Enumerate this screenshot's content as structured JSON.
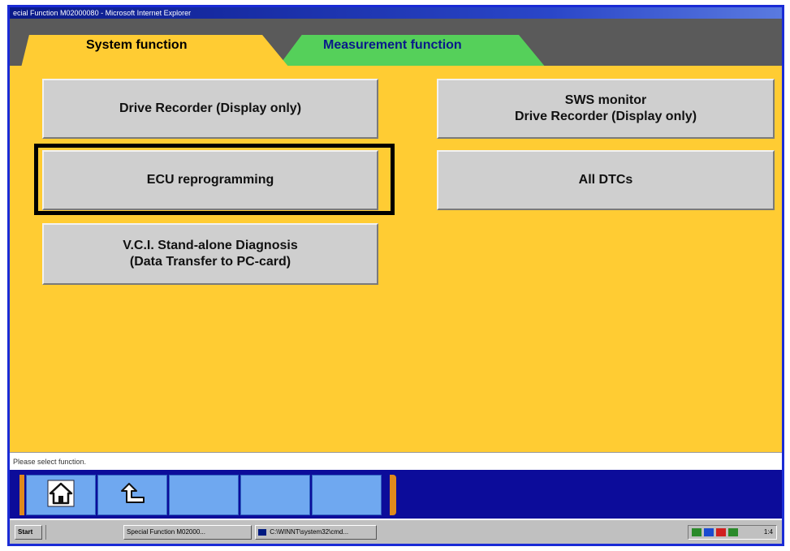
{
  "window": {
    "title": "ecial Function M02000080 - Microsoft Internet Explorer"
  },
  "tabs": {
    "system_label": "System function",
    "measurement_label": "Measurement function"
  },
  "functions": {
    "drive_recorder": "Drive Recorder (Display only)",
    "sws_monitor_line1": "SWS monitor",
    "sws_monitor_line2": "Drive Recorder (Display only)",
    "ecu_reprogramming": "ECU reprogramming",
    "all_dtcs": "All DTCs",
    "vci_line1": "V.C.I. Stand-alone Diagnosis",
    "vci_line2": "(Data Transfer to PC-card)"
  },
  "status": {
    "message": "Please select function."
  },
  "toolbar": {
    "home_icon": "home-icon",
    "back_icon": "back-arrow-icon"
  },
  "taskbar": {
    "start_label": "Start",
    "task1_label": "Special Function M02000...",
    "task2_label": "C:\\WINNT\\system32\\cmd...",
    "clock_label": "1:4"
  },
  "colors": {
    "content_bg": "#ffcc33",
    "system_tab": "#ffcc33",
    "measurement_tab": "#55d05a",
    "toolbar_bg": "#0c0c9a",
    "window_border": "#1a2bd6"
  }
}
